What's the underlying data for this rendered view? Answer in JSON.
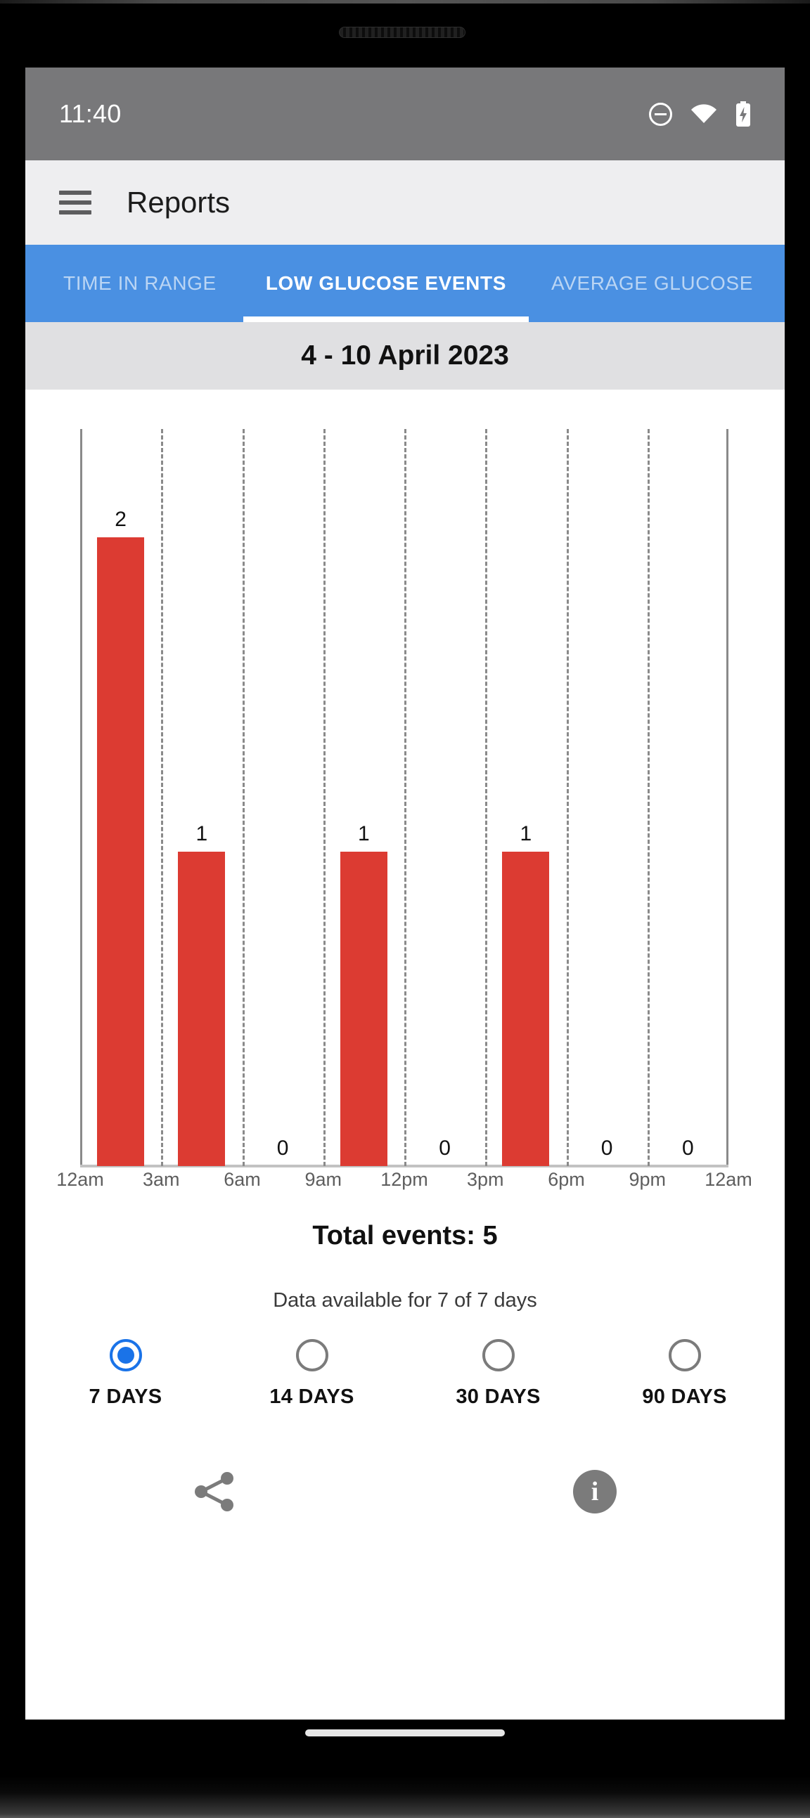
{
  "status_bar": {
    "time": "11:40",
    "icons": [
      "do-not-disturb-icon",
      "wifi-icon",
      "battery-charging-icon"
    ]
  },
  "app_bar": {
    "menu_icon": "hamburger-menu-icon",
    "title": "Reports"
  },
  "tabs": [
    {
      "label": "TIME IN RANGE",
      "active": false
    },
    {
      "label": "LOW GLUCOSE EVENTS",
      "active": true
    },
    {
      "label": "AVERAGE GLUCOSE",
      "active": false
    }
  ],
  "date_range": "4 - 10 April 2023",
  "chart_data": {
    "type": "bar",
    "title": "Low Glucose Events",
    "categories": [
      "12am-3am",
      "3am-6am",
      "6am-9am",
      "9am-12pm",
      "12pm-3pm",
      "3pm-6pm",
      "6pm-9pm",
      "9pm-12am"
    ],
    "values": [
      2,
      1,
      0,
      1,
      0,
      1,
      0,
      0
    ],
    "tick_labels": [
      "12am",
      "3am",
      "6am",
      "9am",
      "12pm",
      "3pm",
      "6pm",
      "9pm",
      "12am"
    ],
    "xlabel": "",
    "ylabel": "",
    "ylim": [
      0,
      2.35
    ],
    "grid": true,
    "legend": "none",
    "bar_color": "#dc3b32",
    "data_labels": [
      "2",
      "1",
      "0",
      "1",
      "0",
      "1",
      "0",
      "0"
    ]
  },
  "summary": {
    "total_events": "Total events: 5",
    "data_available": "Data available for 7 of 7 days"
  },
  "range_options": [
    {
      "label": "7 DAYS",
      "selected": true
    },
    {
      "label": "14 DAYS",
      "selected": false
    },
    {
      "label": "30 DAYS",
      "selected": false
    },
    {
      "label": "90 DAYS",
      "selected": false
    }
  ],
  "footer": {
    "share_icon": "share-icon",
    "info_icon": "info-icon"
  },
  "colors": {
    "accent_blue": "#4a90e2",
    "selected_radio": "#1a73e8",
    "bar_red": "#dc3b32",
    "status_bar": "#78787a",
    "app_bar": "#eeeef0",
    "date_bar": "#e0e0e2"
  }
}
